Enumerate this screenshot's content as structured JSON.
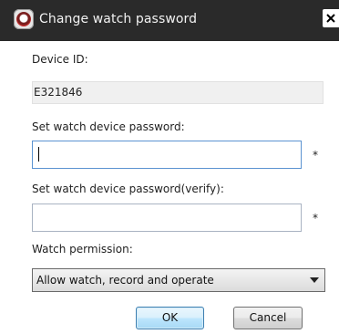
{
  "window": {
    "title": "Change watch password",
    "app_icon": "app-logo-icon",
    "close_icon": "close-icon"
  },
  "form": {
    "device_id_label": "Device ID:",
    "device_id_value": "E321846",
    "password_label": "Set watch device password:",
    "password_value": "",
    "password_verify_label": "Set watch device password(verify):",
    "password_verify_value": "",
    "required_marker": "*",
    "permission_label": "Watch permission:",
    "permission_selected": "Allow watch, record and operate"
  },
  "buttons": {
    "ok_label": "OK",
    "cancel_label": "Cancel"
  }
}
